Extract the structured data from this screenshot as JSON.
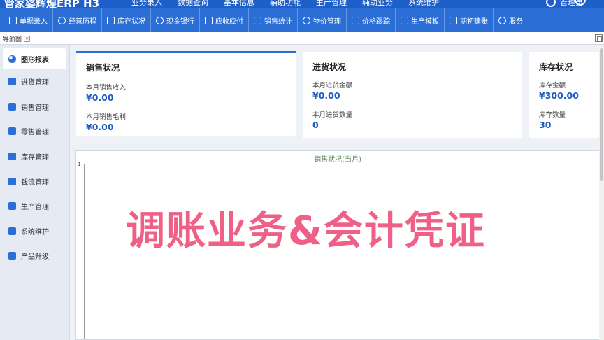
{
  "app": {
    "brand": "管家婆辉煌ERP H3",
    "top_nav": [
      "业务录入",
      "数据查询",
      "基本信息",
      "辅助功能",
      "生产管理",
      "辅助业务",
      "系统维护"
    ],
    "user": "管理员"
  },
  "toolbar": [
    {
      "label": "单据录入",
      "icon": "edit-icon"
    },
    {
      "label": "经营历程",
      "icon": "history-icon"
    },
    {
      "label": "库存状况",
      "icon": "box-icon"
    },
    {
      "label": "现金银行",
      "icon": "bank-icon"
    },
    {
      "label": "应收应付",
      "icon": "ledger-icon"
    },
    {
      "label": "销售统计",
      "icon": "stats-icon"
    },
    {
      "label": "物价管理",
      "icon": "price-icon"
    },
    {
      "label": "价格跟踪",
      "icon": "track-icon"
    },
    {
      "label": "生产模板",
      "icon": "template-icon"
    },
    {
      "label": "期初建账",
      "icon": "book-icon"
    },
    {
      "label": "服务",
      "icon": "help-icon"
    }
  ],
  "tab": {
    "label": "导航图"
  },
  "sidebar": {
    "items": [
      {
        "label": "图形报表",
        "icon": "pie-chart-icon",
        "active": true
      },
      {
        "label": "进货管理",
        "icon": "purchase-icon"
      },
      {
        "label": "销售管理",
        "icon": "bar-chart-icon"
      },
      {
        "label": "零售管理",
        "icon": "tag-icon"
      },
      {
        "label": "库存管理",
        "icon": "warehouse-icon"
      },
      {
        "label": "钱流管理",
        "icon": "money-icon"
      },
      {
        "label": "生产管理",
        "icon": "wrench-icon"
      },
      {
        "label": "系统维护",
        "icon": "shield-icon"
      },
      {
        "label": "产品升级",
        "icon": "upgrade-icon"
      }
    ]
  },
  "cards": [
    {
      "title": "销售状况",
      "metrics": [
        {
          "label": "本月销售收入",
          "value": "¥0.00"
        },
        {
          "label": "本月销售毛利",
          "value": "¥0.00"
        }
      ]
    },
    {
      "title": "进货状况",
      "metrics": [
        {
          "label": "本月进货金额",
          "value": "¥0.00"
        },
        {
          "label": "本月进货数量",
          "value": "0"
        }
      ]
    },
    {
      "title": "库存状况",
      "metrics": [
        {
          "label": "库存金额",
          "value": "¥300.00"
        },
        {
          "label": "库存数量",
          "value": "30"
        }
      ]
    }
  ],
  "chart_data": {
    "type": "bar",
    "title": "销售状况(当月)",
    "y_ticks": [
      "1"
    ],
    "categories": [],
    "values": []
  },
  "overlay": {
    "caption": "调账业务&会计凭证"
  },
  "colors": {
    "primary": "#2b6fd6",
    "value_blue": "#1d5bbf",
    "caption_pink": "#ef5f86"
  }
}
